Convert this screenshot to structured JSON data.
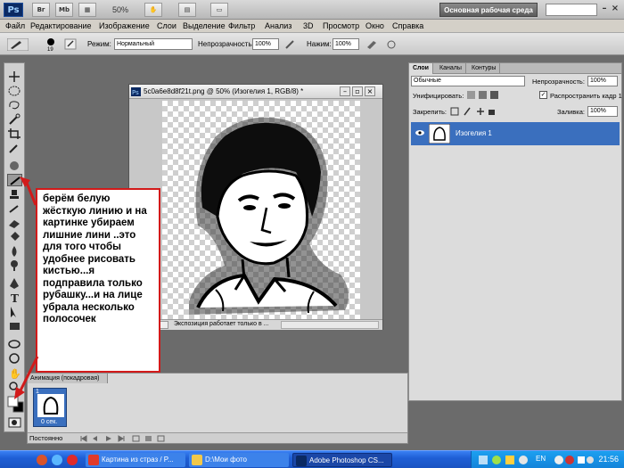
{
  "appbar": {
    "logo": "Ps",
    "btn_br": "Br",
    "btn_mb": "Mb",
    "zoom": "50%",
    "workspace": "Основная рабочая среда"
  },
  "menu": {
    "items": [
      "Файл",
      "Редактирование",
      "Изображение",
      "Слои",
      "Выделение",
      "Фильтр",
      "Анализ",
      "3D",
      "Просмотр",
      "Окно",
      "Справка"
    ]
  },
  "options": {
    "brush_size": "19",
    "mode_label": "Режим:",
    "mode_value": "Нормальный",
    "opacity_label": "Непрозрачность:",
    "opacity_value": "100%",
    "pressure_label": "Нажим:",
    "pressure_value": "100%"
  },
  "document": {
    "title": "5c0a6e8d8f21t.png @ 50% (Изогелия 1, RGB/8) *",
    "status": "Экспозиция работает только в ..."
  },
  "layers_panel": {
    "tabs": [
      "Слои",
      "Каналы",
      "Контуры"
    ],
    "blend_mode": "Обычные",
    "opacity_label": "Непрозрачность:",
    "opacity_value": "100%",
    "unify_label": "Унифицировать:",
    "propagate_label": "Распространить кадр 1",
    "lock_label": "Закрепить:",
    "fill_label": "Заливка:",
    "fill_value": "100%",
    "layer_name": "Изогелия 1"
  },
  "animation_panel": {
    "tab": "Анимация (покадровая)",
    "frame_number": "1",
    "frame_time": "0 сек.",
    "loop": "Постоянно"
  },
  "annotation": {
    "text": "берём белую жёсткую линию и на картинке убираем лишние лини ..это для того чтобы удобнее рисовать кистью...я подправила только рубашку...и на лице убрала несколько полосочек"
  },
  "taskbar": {
    "items": [
      {
        "label": "Картина из страз / P...",
        "color": "#e03a2a"
      },
      {
        "label": "D:\\Мои фото",
        "color": "#f2c84a"
      },
      {
        "label": "Adobe Photoshop CS...",
        "color": "#0b2a63"
      }
    ],
    "language": "EN",
    "time": "21:56"
  },
  "colors": {
    "accent": "#3a6fbe",
    "annotation_border": "#d21a1a",
    "taskbar": "#1f5fd6"
  }
}
